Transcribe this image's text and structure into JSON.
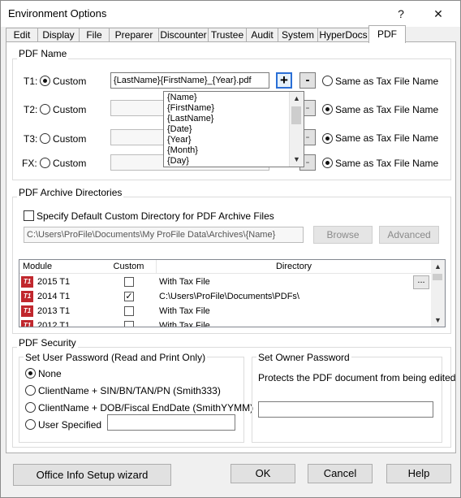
{
  "window": {
    "title": "Environment Options",
    "help_glyph": "?",
    "close_glyph": "✕"
  },
  "tabs": [
    "Edit",
    "Display",
    "File",
    "Preparer",
    "Discounter",
    "Trustee",
    "Audit",
    "System",
    "HyperDocs",
    "PDF"
  ],
  "active_tab": "PDF",
  "pdf_name": {
    "group_label": "PDF Name",
    "custom_label": "Custom",
    "same_label": "Same as Tax File Name",
    "rows": [
      {
        "prefix": "T1:",
        "value": "{LastName}{FirstName}_{Year}.pdf"
      },
      {
        "prefix": "T2:",
        "value": ""
      },
      {
        "prefix": "T3:",
        "value": ""
      },
      {
        "prefix": "FX:",
        "value": ""
      }
    ],
    "plus_label": "+",
    "minus_label": "-",
    "dropdown_items": [
      "{Name}",
      "{FirstName}",
      "{LastName}",
      "{Date}",
      "{Year}",
      "{Month}",
      "{Day}"
    ]
  },
  "archive": {
    "group_label": "PDF Archive Directories",
    "checkbox_label": "Specify Default Custom Directory for PDF Archive Files",
    "path_value": "C:\\Users\\ProFile\\Documents\\My ProFile Data\\Archives\\{Name}",
    "browse_label": "Browse",
    "advanced_label": "Advanced",
    "columns": [
      "Module",
      "Custom",
      "Directory"
    ],
    "rows": [
      {
        "icon": "T1",
        "module": "2015 T1",
        "custom": false,
        "directory": "With Tax File"
      },
      {
        "icon": "T1",
        "module": "2014 T1",
        "custom": true,
        "directory": "C:\\Users\\ProFile\\Documents\\PDFs\\"
      },
      {
        "icon": "T1",
        "module": "2013 T1",
        "custom": false,
        "directory": "With Tax File"
      },
      {
        "icon": "T1",
        "module": "2012 T1",
        "custom": false,
        "directory": "With Tax File"
      }
    ],
    "ellipsis": "..."
  },
  "security": {
    "group_label": "PDF Security",
    "user_pw_label": "Set User Password (Read and Print Only)",
    "options": [
      "None",
      "ClientName + SIN/BN/TAN/PN (Smith333)",
      "ClientName + DOB/Fiscal EndDate (SmithYYMM)",
      "User Specified"
    ],
    "selected": "None",
    "owner_pw_label": "Set Owner Password",
    "owner_desc": "Protects the PDF document from being edited"
  },
  "footer": {
    "wizard_label": "Office Info Setup wizard",
    "ok_label": "OK",
    "cancel_label": "Cancel",
    "help_label": "Help"
  }
}
